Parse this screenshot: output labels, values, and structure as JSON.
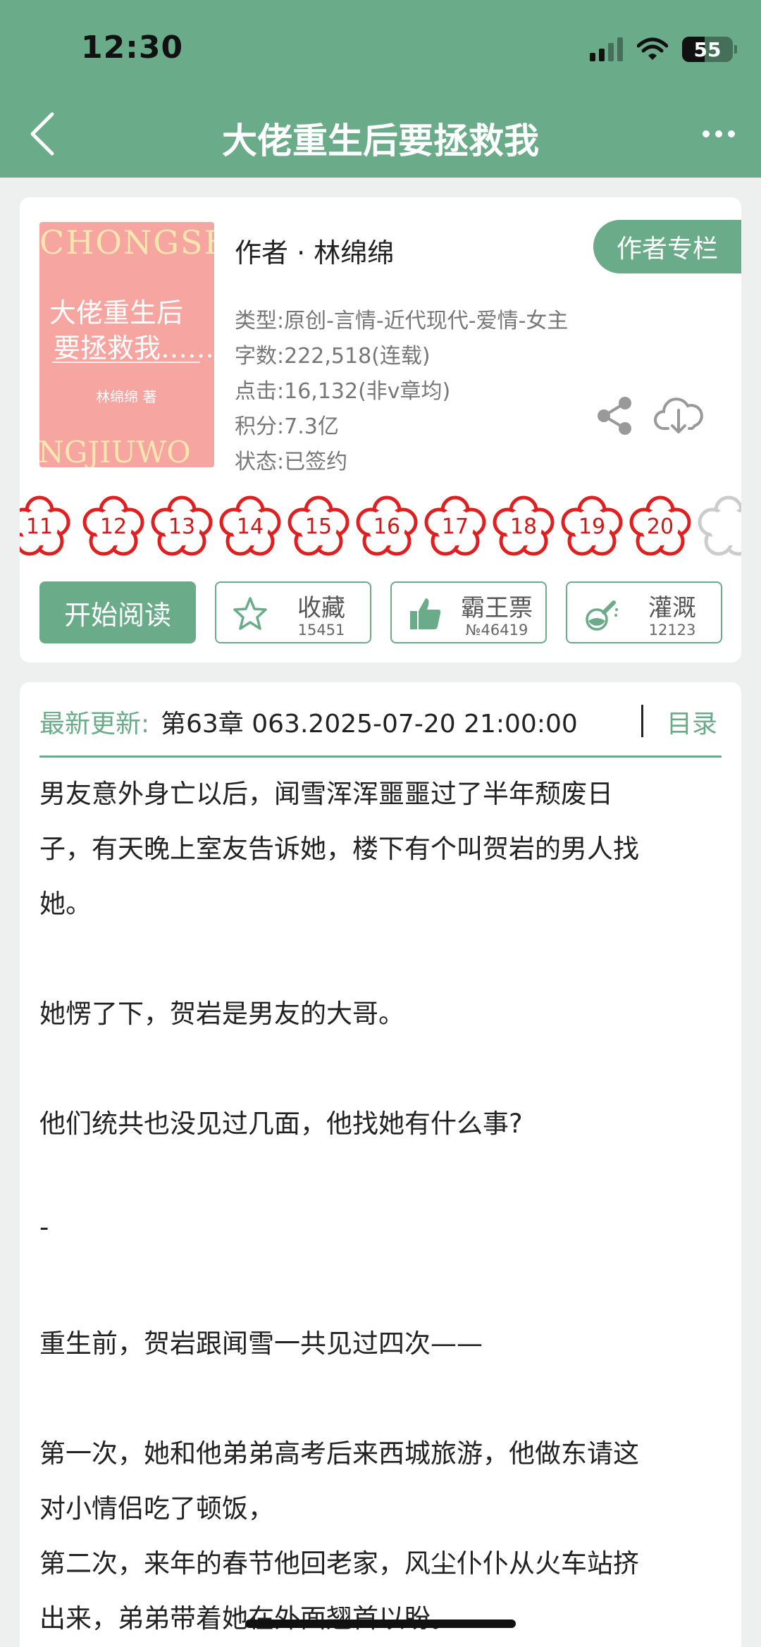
{
  "status_bar": {
    "time": "12:30",
    "battery": "55"
  },
  "nav": {
    "title": "大佬重生后要拯救我"
  },
  "book": {
    "cover": {
      "top_text": "CHONGSH",
      "title_line1": "大佬重生后",
      "title_line2": "要拯救我……",
      "author": "林绵绵 著",
      "bottom_text": "NGJIUWO"
    },
    "author_line": "作者 · 林绵绵",
    "author_column_label": "作者专栏",
    "meta": {
      "genre": "类型:原创-言情-近代现代-爱情-女主",
      "words": "字数:222,518(连载)",
      "clicks": "点击:16,132(非v章均)",
      "points": "积分:7.3亿",
      "status": "状态:已签约"
    }
  },
  "flowers": [
    "11",
    "12",
    "13",
    "14",
    "15",
    "16",
    "17",
    "18",
    "19",
    "20"
  ],
  "actions": {
    "read_label": "开始阅读",
    "favorite": {
      "label": "收藏",
      "count": "15451"
    },
    "tickets": {
      "label": "霸王票",
      "count": "№46419"
    },
    "nutrient": {
      "label": "灌溉",
      "count": "12123"
    }
  },
  "update": {
    "label": "最新更新:",
    "value": "第63章 063.2025-07-20 21:00:00",
    "toc_label": "目录"
  },
  "synopsis": {
    "p1_l1": "男友意外身亡以后，闻雪浑浑噩噩过了半年颓废日",
    "p1_l2": "子，有天晚上室友告诉她，楼下有个叫贺岩的男人找",
    "p1_l3": "她。",
    "p2": "她愣了下，贺岩是男友的大哥。",
    "p3": "他们统共也没见过几面，他找她有什么事?",
    "p4": "-",
    "p5": "重生前，贺岩跟闻雪一共见过四次——",
    "p6_l1": "第一次，她和他弟弟高考后来西城旅游，他做东请这",
    "p6_l2": "对小情侣吃了顿饭，",
    "p7_l1": "第二次，来年的春节他回老家，风尘仆仆从火车站挤",
    "p7_l2": "出来，弟弟带着她在外面翘首以盼。"
  },
  "colors": {
    "accent": "#6aab89",
    "flower_red": "#d01818",
    "cover_pink": "#f6a5a1"
  }
}
